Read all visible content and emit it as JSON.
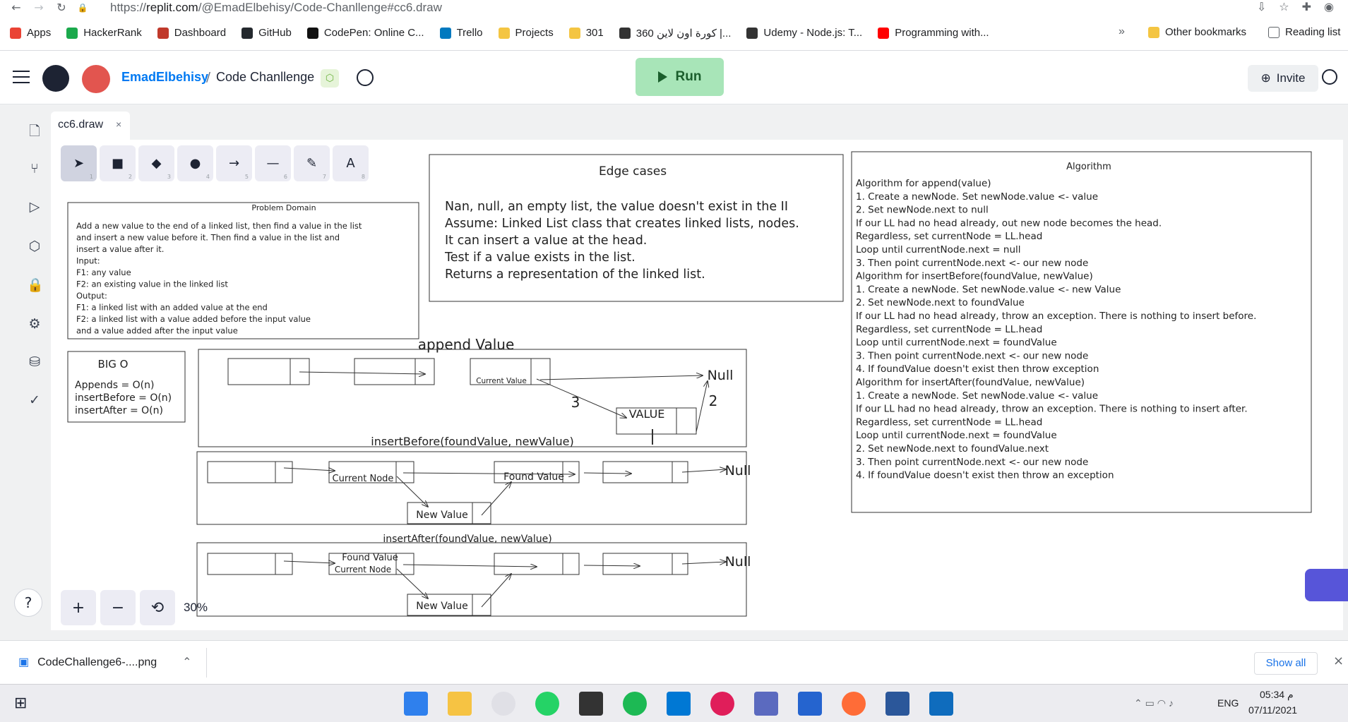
{
  "browser": {
    "url_scheme": "https://",
    "url_host": "replit.com",
    "url_path": "/@EmadElbehisy/Code-Chanllenge#cc6.draw",
    "bookmarks": [
      {
        "label": "Apps",
        "color": "#ea4335"
      },
      {
        "label": "HackerRank",
        "color": "#1ba94c"
      },
      {
        "label": "Dashboard",
        "color": "#c0392b"
      },
      {
        "label": "GitHub",
        "color": "#24292e"
      },
      {
        "label": "CodePen: Online C...",
        "color": "#111111"
      },
      {
        "label": "Trello",
        "color": "#0079bf"
      },
      {
        "label": "Projects",
        "color": "#f4c542"
      },
      {
        "label": "301",
        "color": "#f4c542"
      },
      {
        "label": "360 كورة اون لاين |...",
        "color": "#333333"
      },
      {
        "label": "Udemy - Node.js: T...",
        "color": "#333333"
      },
      {
        "label": "Programming with...",
        "color": "#ff0000"
      }
    ],
    "more_label": "»",
    "other_bookmarks": "Other bookmarks",
    "reading_list": "Reading list"
  },
  "header": {
    "username": "EmadElbehisy",
    "separator": "/",
    "project": "Code Chanllenge",
    "run_label": "Run",
    "invite_label": "Invite"
  },
  "tab": {
    "label": "cc6.draw",
    "close": "×"
  },
  "toolbar": {
    "tools": [
      {
        "name": "select",
        "num": "1",
        "glyph": "➤"
      },
      {
        "name": "rectangle",
        "num": "2",
        "glyph": "■"
      },
      {
        "name": "diamond",
        "num": "3",
        "glyph": "◆"
      },
      {
        "name": "ellipse",
        "num": "4",
        "glyph": "●"
      },
      {
        "name": "arrow",
        "num": "5",
        "glyph": "→"
      },
      {
        "name": "line",
        "num": "6",
        "glyph": "—"
      },
      {
        "name": "draw",
        "num": "7",
        "glyph": "✎"
      },
      {
        "name": "text",
        "num": "8",
        "glyph": "A"
      }
    ]
  },
  "zoom": {
    "plus": "+",
    "minus": "−",
    "reset": "⟲",
    "level": "30%"
  },
  "help": "?",
  "drawing": {
    "problem_domain": {
      "title": "Problem Domain",
      "lines": [
        "Add a new value to the end of a linked list, then find a value in the list",
        "and insert a new value before it. Then find a value in the list and",
        "insert a value after it.",
        "Input:",
        "F1: any value",
        "F2: an existing value in the linked list",
        "Output:",
        "F1: a linked list with an added value at the end",
        "F2: a linked list with a value added before the input value",
        "and a value added after the input value"
      ]
    },
    "edge_cases": {
      "title": "Edge cases",
      "lines": [
        "Nan, null, an empty list, the value doesn't exist in the II",
        "Assume: Linked List class that creates linked lists, nodes.",
        "It can insert a value at the head.",
        "Test if a value exists in the list.",
        "Returns a representation of the linked list."
      ]
    },
    "algorithm": {
      "title": "Algorithm",
      "lines": [
        "Algorithm for append(value)",
        "1. Create a newNode. Set newNode.value <- value",
        "2. Set newNode.next to null",
        "If our LL had no head already, out new node becomes the head.",
        "Regardless, set currentNode = LL.head",
        "Loop until currentNode.next = null",
        "3. Then point currentNode.next <- our new node",
        "Algorithm for insertBefore(foundValue, newValue)",
        "1. Create a newNode. Set newNode.value <- new Value",
        "2. Set newNode.next to foundValue",
        "If our LL had no head already, throw an exception. There is nothing to insert before.",
        "Regardless, set currentNode = LL.head",
        "Loop until currentNode.next = foundValue",
        "3. Then point currentNode.next <- our new node",
        "4. If foundValue doesn't exist then throw exception",
        "Algorithm for insertAfter(foundValue, newValue)",
        "1. Create a newNode. Set newNode.value <- value",
        "If our LL had no head already, throw an exception. There is nothing to insert after.",
        "Regardless, set currentNode = LL.head",
        "Loop until currentNode.next = foundValue",
        "2. Set newNode.next to foundValue.next",
        "3. Then point currentNode.next <- our new node",
        "4. If foundValue doesn't exist then throw an exception"
      ]
    },
    "big_o": {
      "title": "BIG O",
      "lines": [
        "Appends = O(n)",
        "insertBefore = O(n)",
        "insertAfter = O(n)"
      ]
    },
    "append": {
      "title": "append Value",
      "current": "Current Value",
      "null": "Null",
      "value": "VALUE",
      "n3": "3",
      "n2": "2",
      "n1": "1"
    },
    "insert_before": {
      "title": "insertBefore(foundValue, newValue)",
      "current": "Current Node",
      "found": "Found Value",
      "new": "New Value",
      "null": "Null"
    },
    "insert_after": {
      "title": "insertAfter(foundValue, newValue)",
      "found": "Found Value",
      "current": "Current Node",
      "new": "New Value",
      "null": "Null"
    }
  },
  "downloads": {
    "file": "CodeChallenge6-....png",
    "show_all": "Show all",
    "close": "×"
  },
  "taskbar": {
    "lang": "ENG",
    "time": "05:34 م",
    "date": "07/11/2021"
  }
}
